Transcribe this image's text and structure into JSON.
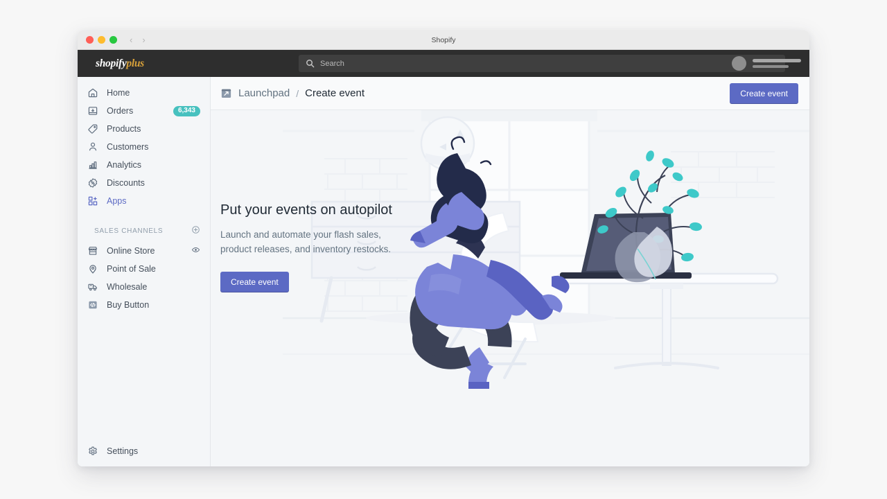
{
  "window": {
    "title": "Shopify",
    "traffic_lights": [
      "close",
      "minimize",
      "maximize"
    ],
    "back_arrow": "‹",
    "forward_arrow": "›"
  },
  "topbar": {
    "logo_main": "shopify",
    "logo_suffix": "plus",
    "search_placeholder": "Search",
    "search_value": ""
  },
  "sidebar": {
    "items": [
      {
        "label": "Home",
        "icon": "home-icon",
        "badge": null,
        "active": false
      },
      {
        "label": "Orders",
        "icon": "orders-icon",
        "badge": "6,343",
        "active": false
      },
      {
        "label": "Products",
        "icon": "products-tag-icon",
        "badge": null,
        "active": false
      },
      {
        "label": "Customers",
        "icon": "customers-icon",
        "badge": null,
        "active": false
      },
      {
        "label": "Analytics",
        "icon": "analytics-bars-icon",
        "badge": null,
        "active": false
      },
      {
        "label": "Discounts",
        "icon": "discounts-percent-icon",
        "badge": null,
        "active": false
      },
      {
        "label": "Apps",
        "icon": "apps-grid-plus-icon",
        "badge": null,
        "active": true
      }
    ],
    "section": {
      "title": "SALES CHANNELS",
      "add_icon": "plus-circle-icon",
      "channels": [
        {
          "label": "Online Store",
          "icon": "online-store-icon",
          "trailing_icon": "eye-icon"
        },
        {
          "label": "Point of Sale",
          "icon": "location-pin-icon",
          "trailing_icon": null
        },
        {
          "label": "Wholesale",
          "icon": "truck-icon",
          "trailing_icon": null
        },
        {
          "label": "Buy Button",
          "icon": "code-brackets-icon",
          "trailing_icon": null
        }
      ]
    },
    "settings": {
      "label": "Settings",
      "icon": "gear-icon"
    }
  },
  "main": {
    "breadcrumb": {
      "icon": "launchpad-icon",
      "parent": "Launchpad",
      "separator": "/",
      "current": "Create event"
    },
    "header_button": "Create event",
    "hero": {
      "heading": "Put your events on autopilot",
      "body": "Launch and automate your flash sales, product releases, and inventory restocks.",
      "cta": "Create event"
    },
    "illustration": "person-at-desk-with-laptop-and-plant"
  },
  "colors": {
    "accent_indigo": "#5c6ac4",
    "badge_teal": "#47c1bf",
    "topbar_dark": "#2e2e2e",
    "surface": "#f4f6f8",
    "text_primary": "#212b36",
    "text_subdued": "#637381"
  }
}
